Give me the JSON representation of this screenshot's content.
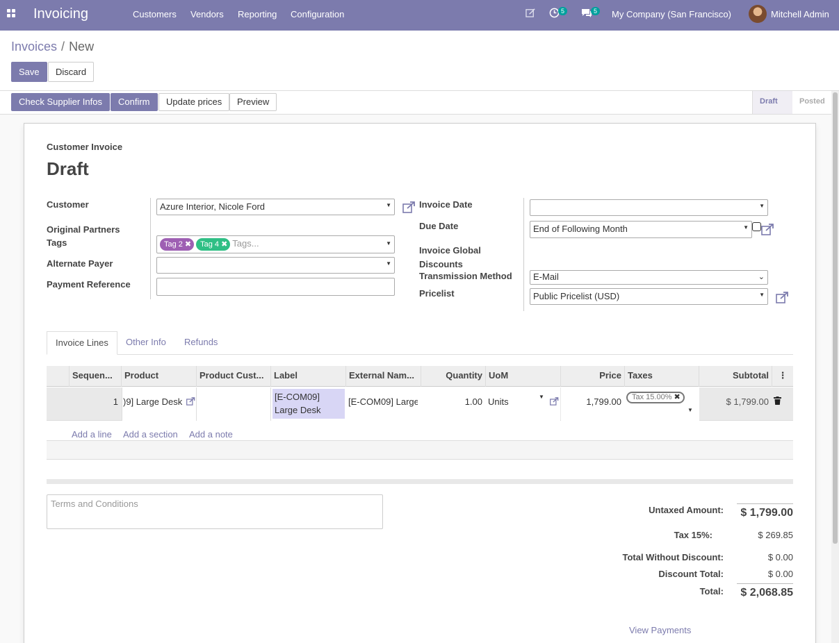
{
  "navbar": {
    "app_name": "Invoicing",
    "menu": [
      "Customers",
      "Vendors",
      "Reporting",
      "Configuration"
    ],
    "activity_count": "5",
    "message_count": "5",
    "company": "My Company (San Francisco)",
    "user": "Mitchell Admin",
    "colors": {
      "brand": "#7c7bad",
      "badge": "#00a09d"
    }
  },
  "breadcrumb": {
    "parent": "Invoices",
    "current": "New"
  },
  "actions": {
    "save": "Save",
    "discard": "Discard"
  },
  "statusbar": {
    "buttons": [
      "Check Supplier Infos",
      "Confirm",
      "Update prices",
      "Preview"
    ],
    "stages": [
      "Draft",
      "Posted"
    ]
  },
  "form": {
    "doc_type": "Customer Invoice",
    "title": "Draft",
    "left_labels": {
      "customer": "Customer",
      "partner_tags": "Original Partners Tags",
      "alternate_payer": "Alternate Payer",
      "payment_reference": "Payment Reference"
    },
    "customer": "Azure Interior, Nicole Ford",
    "tags": [
      {
        "label": "Tag 2",
        "color": "#9e5fb3"
      },
      {
        "label": "Tag 4",
        "color": "#2fbf85"
      }
    ],
    "tags_placeholder": "Tags...",
    "alternate_payer": "",
    "payment_reference": "",
    "right_labels": {
      "invoice_date": "Invoice Date",
      "due_date": "Due Date",
      "global_discounts": "Invoice Global Discounts",
      "transmission_method": "Transmission Method",
      "pricelist": "Pricelist"
    },
    "invoice_date": "",
    "due_date": "End of Following Month",
    "transmission_method": "E-Mail",
    "pricelist": "Public Pricelist (USD)"
  },
  "tabs": [
    "Invoice Lines",
    "Other Info",
    "Refunds"
  ],
  "lines": {
    "headers": [
      "Sequen...",
      "Product",
      "Product Cust...",
      "Label",
      "External Nam...",
      "Quantity",
      "UoM",
      "Price",
      "Taxes",
      "Subtotal"
    ],
    "row": {
      "sequence": "1",
      "product": ")9] Large Desk",
      "product_customer": "",
      "label_line1": "[E-COM09]",
      "label_line2": "Large Desk",
      "external_name": "[E-COM09] Large",
      "quantity": "1.00",
      "uom": "Units",
      "price": "1,799.00",
      "tax": "Tax 15.00%",
      "subtotal": "$ 1,799.00"
    },
    "add_links": [
      "Add a line",
      "Add a section",
      "Add a note"
    ]
  },
  "terms_placeholder": "Terms and Conditions",
  "totals": {
    "untaxed_label": "Untaxed Amount:",
    "untaxed": "$ 1,799.00",
    "tax_label": "Tax 15%:",
    "tax": "$ 269.85",
    "without_discount_label": "Total Without Discount:",
    "without_discount": "$ 0.00",
    "discount_label": "Discount Total:",
    "discount": "$ 0.00",
    "total_label": "Total:",
    "total": "$ 2,068.85",
    "view_payments": "View Payments"
  }
}
